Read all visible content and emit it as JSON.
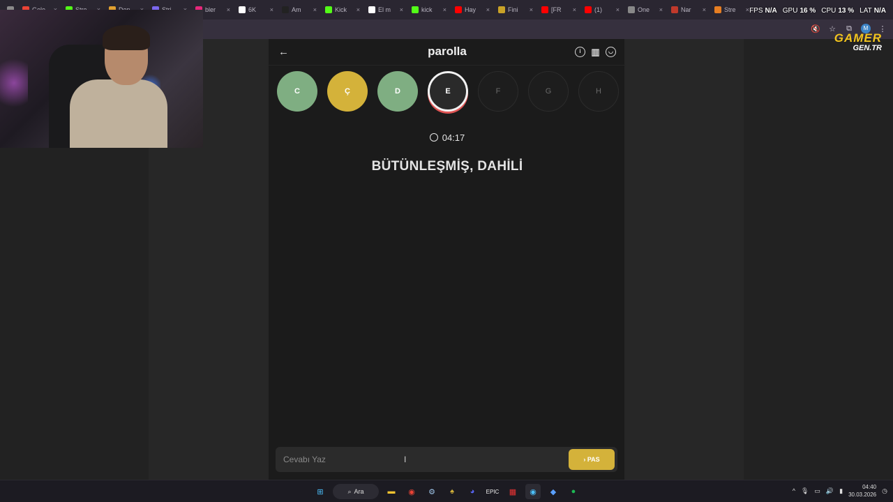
{
  "browser": {
    "tabs": [
      {
        "label": "",
        "color": "#8b8b8b"
      },
      {
        "label": "Gele",
        "color": "#ea4335"
      },
      {
        "label": "Stre",
        "color": "#53fc18"
      },
      {
        "label": "Dep",
        "color": "#e0a030"
      },
      {
        "label": "Stri",
        "color": "#7b68ee"
      },
      {
        "label": "bler",
        "color": "#e6277a"
      },
      {
        "label": "6K",
        "color": "#ffffff"
      },
      {
        "label": "Am",
        "color": "#222222"
      },
      {
        "label": "Kick",
        "color": "#53fc18"
      },
      {
        "label": "El m",
        "color": "#ffffff"
      },
      {
        "label": "kick",
        "color": "#53fc18"
      },
      {
        "label": "Hay",
        "color": "#ff0000"
      },
      {
        "label": "Fini",
        "color": "#c9a227"
      },
      {
        "label": "[FR",
        "color": "#ff0000"
      },
      {
        "label": "(1)",
        "color": "#ff0000"
      },
      {
        "label": "One",
        "color": "#888888"
      },
      {
        "label": "Nar",
        "color": "#c0392b"
      },
      {
        "label": "Stre",
        "color": "#e67e22"
      }
    ],
    "avatar_initial": "M"
  },
  "overlay": {
    "fps_label": "FPS",
    "fps_value": "N/A",
    "gpu_label": "GPU",
    "gpu_value": "16 %",
    "cpu_label": "CPU",
    "cpu_value": "13 %",
    "lat_label": "LAT",
    "lat_value": "N/A",
    "logo_line1": "GAMER",
    "logo_line2": "GEN.TR"
  },
  "game": {
    "title": "parolla",
    "letters": [
      {
        "char": "C",
        "state": "green"
      },
      {
        "char": "Ç",
        "state": "yellow"
      },
      {
        "char": "D",
        "state": "green"
      },
      {
        "char": "E",
        "state": "current"
      },
      {
        "char": "F",
        "state": "future"
      },
      {
        "char": "G",
        "state": "future"
      },
      {
        "char": "H",
        "state": "future"
      }
    ],
    "timer": "04:17",
    "clue": "BÜTÜNLEŞMİŞ, DAHİLİ",
    "input_placeholder": "Cevabı Yaz",
    "pass_label": "› PAS",
    "colors": {
      "green": "#7fae82",
      "yellow": "#d4b23a",
      "current_ring": "#e05555"
    }
  },
  "taskbar": {
    "search_label": "Ara",
    "time": "04:40",
    "date": "30.03.2026",
    "apps": [
      "windows-icon",
      "search",
      "file-explorer-icon",
      "chrome-icon",
      "steam-icon",
      "app-icon",
      "discord-icon",
      "epic-icon",
      "app-icon",
      "chrome-icon",
      "app-icon",
      "spotify-icon"
    ]
  }
}
